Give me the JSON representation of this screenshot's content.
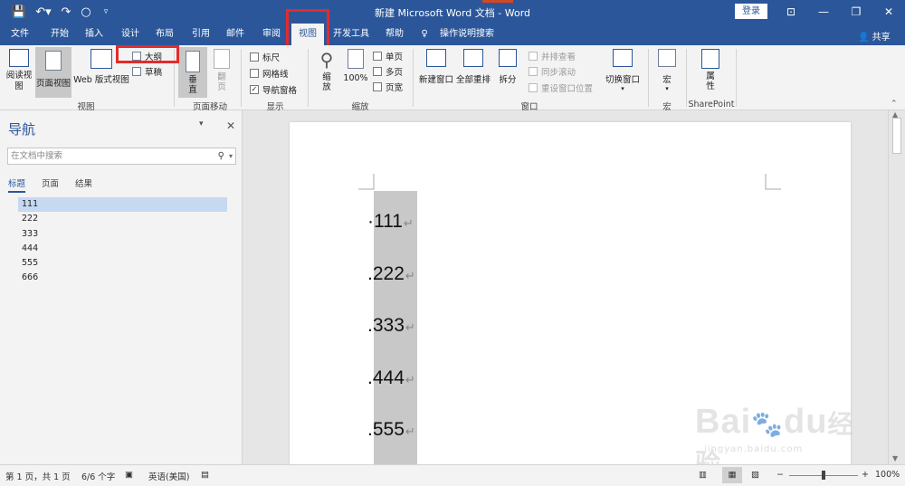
{
  "app": {
    "title": "新建 Microsoft Word 文档 - Word",
    "login_label": "登录",
    "share_label": "共享"
  },
  "tabs": [
    "文件",
    "开始",
    "插入",
    "设计",
    "布局",
    "引用",
    "邮件",
    "审阅",
    "视图",
    "开发工具",
    "帮助"
  ],
  "tell_me": "操作说明搜索",
  "ribbon": {
    "views": {
      "read_mode": "阅读视图",
      "print_layout": "页面视图",
      "web_layout": "Web 版式视图",
      "outline": "大纲",
      "draft": "草稿",
      "group_label": "视图"
    },
    "page_movement": {
      "vertical": "垂直",
      "side_by_side": "翻页",
      "group_label": "页面移动"
    },
    "show": {
      "ruler": "标尺",
      "gridlines": "网格线",
      "nav_pane": "导航窗格",
      "group_label": "显示"
    },
    "zoom": {
      "zoom": "缩放",
      "hundred": "100%",
      "one_page": "单页",
      "multiple_pages": "多页",
      "page_width": "页宽",
      "group_label": "缩放"
    },
    "window": {
      "new_window": "新建窗口",
      "arrange_all": "全部重排",
      "split": "拆分",
      "side_by_side": "并排查看",
      "sync_scroll": "同步滚动",
      "reset_position": "重设窗口位置",
      "switch_windows": "切换窗口",
      "group_label": "窗口"
    },
    "macros": {
      "macros": "宏",
      "group_label": "宏"
    },
    "sharepoint": {
      "properties": "属性",
      "group_label": "SharePoint"
    }
  },
  "nav": {
    "title": "导航",
    "search_placeholder": "在文档中搜索",
    "tabs": [
      "标题",
      "页面",
      "结果"
    ],
    "headings": [
      "111",
      "222",
      "333",
      "444",
      "555",
      "666"
    ]
  },
  "document": {
    "paragraphs": [
      "111",
      "222",
      "333",
      "444",
      "555"
    ],
    "paragraph_mark": "↵"
  },
  "status": {
    "page": "第 1 页，共 1 页",
    "words": "6/6 个字",
    "language": "英语(美国)",
    "zoom_level": "100%",
    "zoom_fraction": 0.5
  },
  "watermark": {
    "brand": "Bai",
    "brand2": "du",
    "cn": "经验",
    "url": "jingyan.baidu.com"
  },
  "colors": {
    "ribbon_blue": "#2b579a",
    "highlight_red": "#e32b2b"
  }
}
